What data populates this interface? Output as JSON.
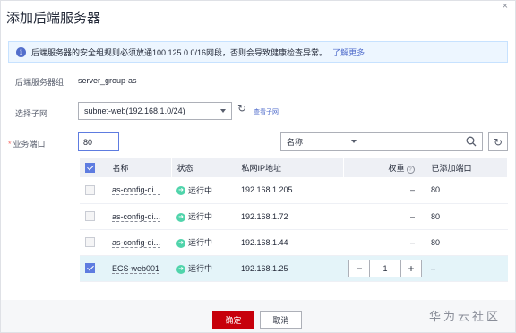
{
  "dialog": {
    "title": "添加后端服务器",
    "close_glyph": "×"
  },
  "notice": {
    "text": "后端服务器的安全组规则必须放通100.125.0.0/16网段，否则会导致健康检查异常。",
    "link": "了解更多",
    "icon": "info-icon"
  },
  "server_group": {
    "label": "后端服务器组",
    "value": "server_group-as"
  },
  "subnet": {
    "label": "选择子网",
    "selected": "subnet-web(192.168.1.0/24)",
    "view_link": "查看子网"
  },
  "port": {
    "required_mark": "*",
    "label": "业务端口",
    "value": "80"
  },
  "search": {
    "filter_selected": "名称",
    "input_value": ""
  },
  "table": {
    "headers": {
      "name": "名称",
      "status": "状态",
      "ip": "私网IP地址",
      "weight": "权重",
      "added_port": "已添加端口"
    },
    "rows": [
      {
        "name": "as-config-di...",
        "status": "运行中",
        "ip": "192.168.1.205",
        "weight": "–",
        "added_port": "80",
        "checked": false
      },
      {
        "name": "as-config-di...",
        "status": "运行中",
        "ip": "192.168.1.72",
        "weight": "–",
        "added_port": "80",
        "checked": false
      },
      {
        "name": "as-config-di...",
        "status": "运行中",
        "ip": "192.168.1.44",
        "weight": "–",
        "added_port": "80",
        "checked": false
      },
      {
        "name": "ECS-web001",
        "status": "运行中",
        "ip": "192.168.1.25",
        "weight": "1",
        "added_port": "–",
        "checked": true
      }
    ],
    "stepper": {
      "minus": "−",
      "plus": "+"
    }
  },
  "footer": {
    "ok": "确定",
    "cancel": "取消",
    "watermark": "华为云社区"
  },
  "colors": {
    "primary": "#c7000b",
    "accent": "#5e7ce0",
    "status_running": "#50d4ab",
    "selected_row": "#e4f4f9"
  }
}
